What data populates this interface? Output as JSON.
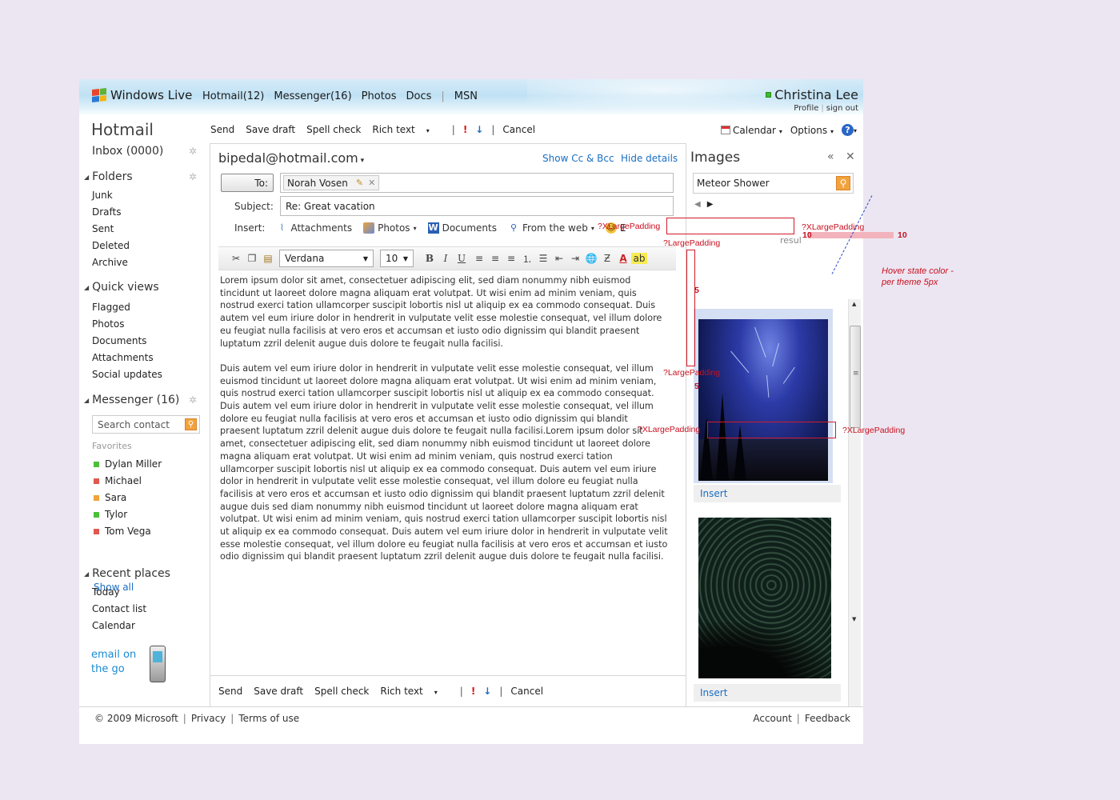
{
  "brand": {
    "name": "Windows Live"
  },
  "topnav": [
    {
      "label": "Hotmail",
      "count": "(12)"
    },
    {
      "label": "Messenger",
      "count": "(16)"
    },
    {
      "label": "Photos",
      "count": ""
    },
    {
      "label": "Docs",
      "count": ""
    },
    {
      "label": "MSN",
      "count": ""
    }
  ],
  "user": {
    "name": "Christina Lee",
    "profile": "Profile",
    "signout": "sign out",
    "presence_color": "#3cbc2c"
  },
  "left": {
    "app_title": "Hotmail",
    "inbox": "Inbox (0000)",
    "folders": {
      "title": "Folders",
      "items": [
        "Junk",
        "Drafts",
        "Sent",
        "Deleted",
        "Archive"
      ]
    },
    "quick_views": {
      "title": "Quick views",
      "items": [
        "Flagged",
        "Photos",
        "Documents",
        "Attachments",
        "Social updates"
      ]
    },
    "messenger": {
      "title": "Messenger (16)",
      "search_placeholder": "Search contact",
      "favorites_label": "Favorites",
      "contacts": [
        {
          "name": "Dylan Miller",
          "status_color": "#4cbf3a"
        },
        {
          "name": "Michael",
          "status_color": "#e0584f"
        },
        {
          "name": "Sara",
          "status_color": "#f0a33a"
        },
        {
          "name": "Tylor",
          "status_color": "#4cbf3a"
        },
        {
          "name": "Tom Vega",
          "status_color": "#e0584f"
        }
      ],
      "show_all": "Show all"
    },
    "recent": {
      "title": "Recent places",
      "items": [
        "Today",
        "Contact list",
        "Calendar"
      ]
    },
    "promo": "email on the go"
  },
  "toolbar": {
    "send": "Send",
    "save_draft": "Save draft",
    "spell_check": "Spell check",
    "rich_text": "Rich text",
    "cancel": "Cancel",
    "calendar": "Calendar",
    "options": "Options"
  },
  "compose": {
    "from": "bipedal@hotmail.com",
    "show_cc": "Show Cc & Bcc",
    "hide_details": "Hide details",
    "to_label": "To:",
    "recipient": "Norah Vosen",
    "subject_label": "Subject:",
    "subject": "Re: Great vacation",
    "insert_label": "Insert:",
    "insert_items": [
      "Attachments",
      "Photos",
      "Documents",
      "From the web"
    ],
    "insert_more": "E",
    "font": "Verdana",
    "size": "10",
    "body": [
      "Lorem ipsum dolor sit amet, consectetuer adipiscing elit, sed diam nonummy nibh euismod tincidunt ut laoreet dolore magna aliquam erat volutpat. Ut wisi enim ad minim veniam, quis nostrud exerci tation ullamcorper suscipit lobortis nisl ut aliquip ex ea commodo consequat. Duis autem vel eum iriure dolor in hendrerit in vulputate velit esse molestie consequat, vel illum dolore eu feugiat nulla facilisis at vero eros et accumsan et iusto odio dignissim qui blandit praesent luptatum zzril delenit augue duis dolore te feugait nulla facilisi.",
      "Duis autem vel eum iriure dolor in hendrerit in vulputate velit esse molestie consequat, vel illum  euismod tincidunt ut laoreet dolore magna aliquam erat volutpat. Ut wisi enim ad minim veniam, quis nostrud exerci tation ullamcorper suscipit lobortis nisl ut aliquip ex ea commodo consequat. Duis autem vel eum iriure dolor in hendrerit in vulputate velit esse molestie consequat, vel illum dolore eu feugiat nulla facilisis at vero eros et accumsan et iusto odio dignissim qui blandit praesent luptatum zzril delenit augue duis dolore te feugait nulla facilisi.Lorem ipsum dolor sit amet, consectetuer adipiscing elit, sed diam nonummy nibh euismod tincidunt ut laoreet dolore magna aliquam erat volutpat. Ut wisi enim ad minim veniam, quis nostrud exerci tation ullamcorper suscipit lobortis nisl ut aliquip ex ea commodo consequat. Duis autem vel eum iriure dolor in hendrerit in vulputate velit esse molestie consequat, vel illum dolore eu feugiat nulla facilisis at vero eros et accumsan et iusto odio dignissim qui blandit praesent luptatum zzril delenit augue duis  sed diam nonummy nibh euismod tincidunt ut laoreet dolore magna aliquam erat volutpat. Ut wisi enim ad minim veniam, quis nostrud exerci tation ullamcorper suscipit lobortis nisl ut aliquip ex ea commodo consequat. Duis autem vel eum iriure dolor in hendrerit in vulputate velit esse molestie consequat, vel illum dolore eu feugiat nulla facilisis at vero eros et accumsan et iusto odio dignissim qui blandit praesent luptatum zzril delenit augue duis dolore te feugait nulla facilisi."
    ]
  },
  "images_pane": {
    "title": "Images",
    "query": "Meteor Shower",
    "insert_label": "Insert",
    "partial_text": "resul"
  },
  "annotations": {
    "xlarge": "?XLargePadding",
    "large": "?LargePadding",
    "ten": "10",
    "five": "5",
    "hover_note": "Hover state color - per theme 5px"
  },
  "footer": {
    "copyright": "© 2009 Microsoft",
    "privacy": "Privacy",
    "terms": "Terms of use",
    "account": "Account",
    "feedback": "Feedback"
  }
}
